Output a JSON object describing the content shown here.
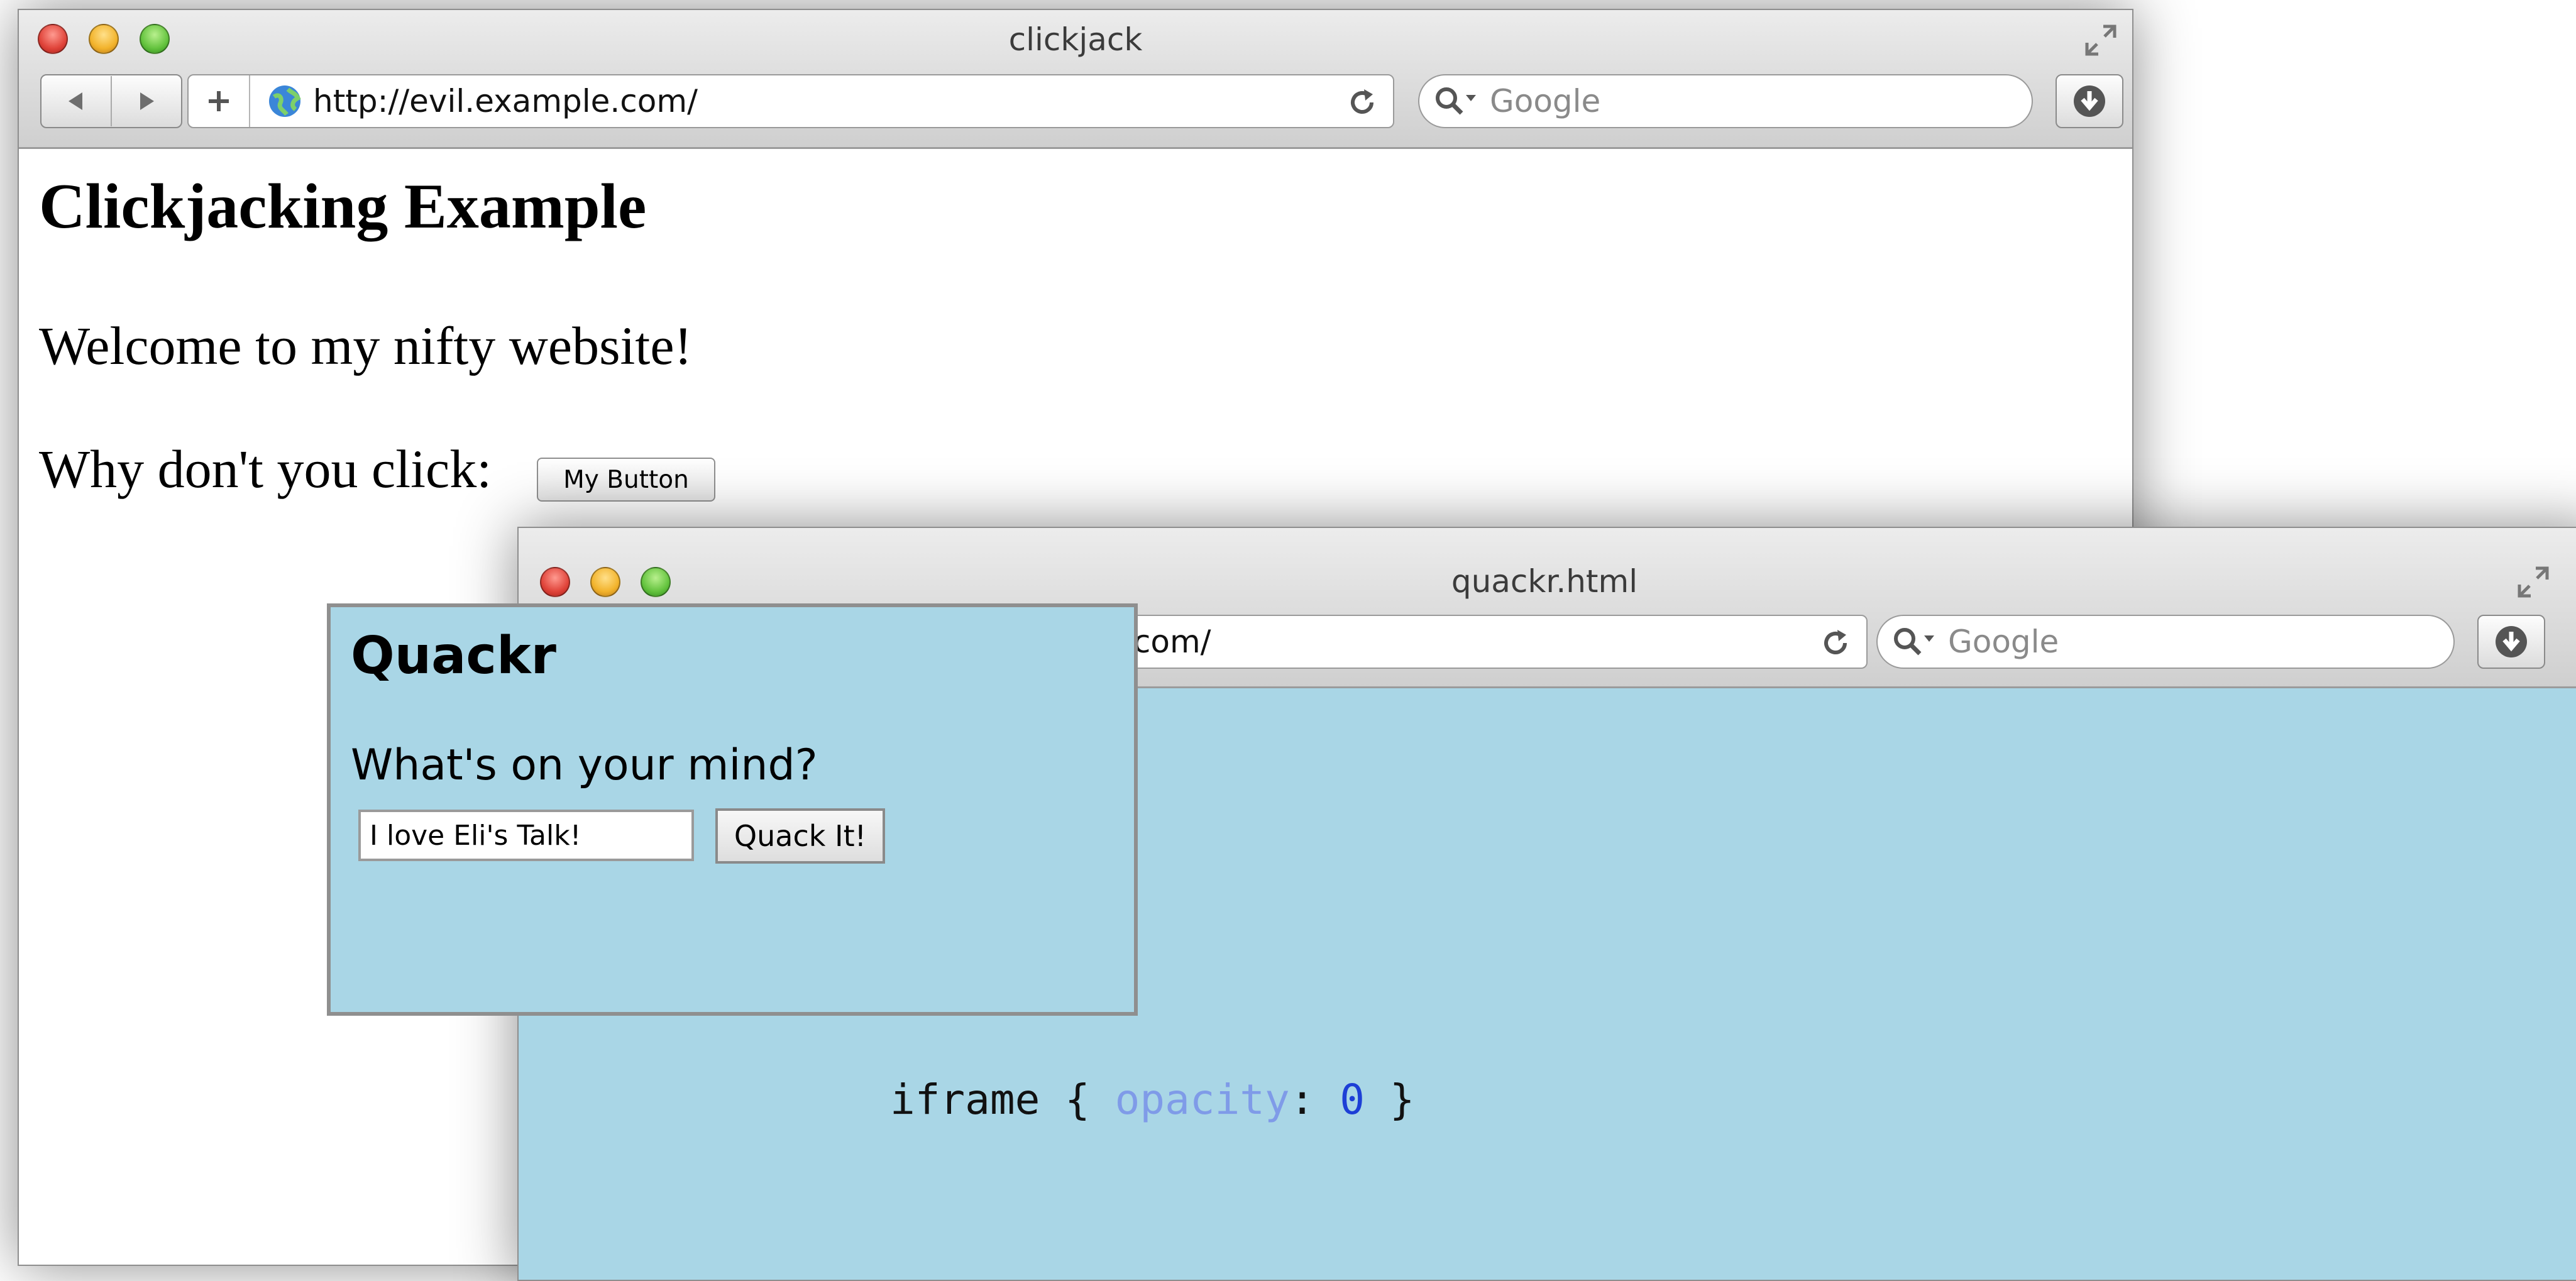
{
  "evil_window": {
    "title": "clickjack",
    "url": "http://evil.example.com/",
    "search_placeholder": "Google",
    "back_icon": "back-arrow-icon",
    "forward_icon": "forward-arrow-icon",
    "add_icon": "plus-icon",
    "reload_icon": "reload-icon",
    "download_icon": "download-icon",
    "page": {
      "heading": "Clickjacking Example",
      "welcome": "Welcome to my nifty website!",
      "prompt": "Why don't you click:",
      "button_label": "My Button"
    }
  },
  "quackr_window": {
    "title": "quackr.html",
    "url_visible": ".com/",
    "search_placeholder": "Google",
    "background_color": "#a9d6e6"
  },
  "quackr_frame": {
    "brand": "Quackr",
    "question": "What's on your mind?",
    "input_value": "I love Eli's Talk!",
    "submit_label": "Quack It!"
  },
  "css_snippet": {
    "selector": "iframe",
    "open_brace": "{",
    "property": "opacity",
    "colon": ":",
    "value": "0",
    "close_brace": "}",
    "property_color": "#7f9be8",
    "value_color": "#1d3fd6"
  }
}
